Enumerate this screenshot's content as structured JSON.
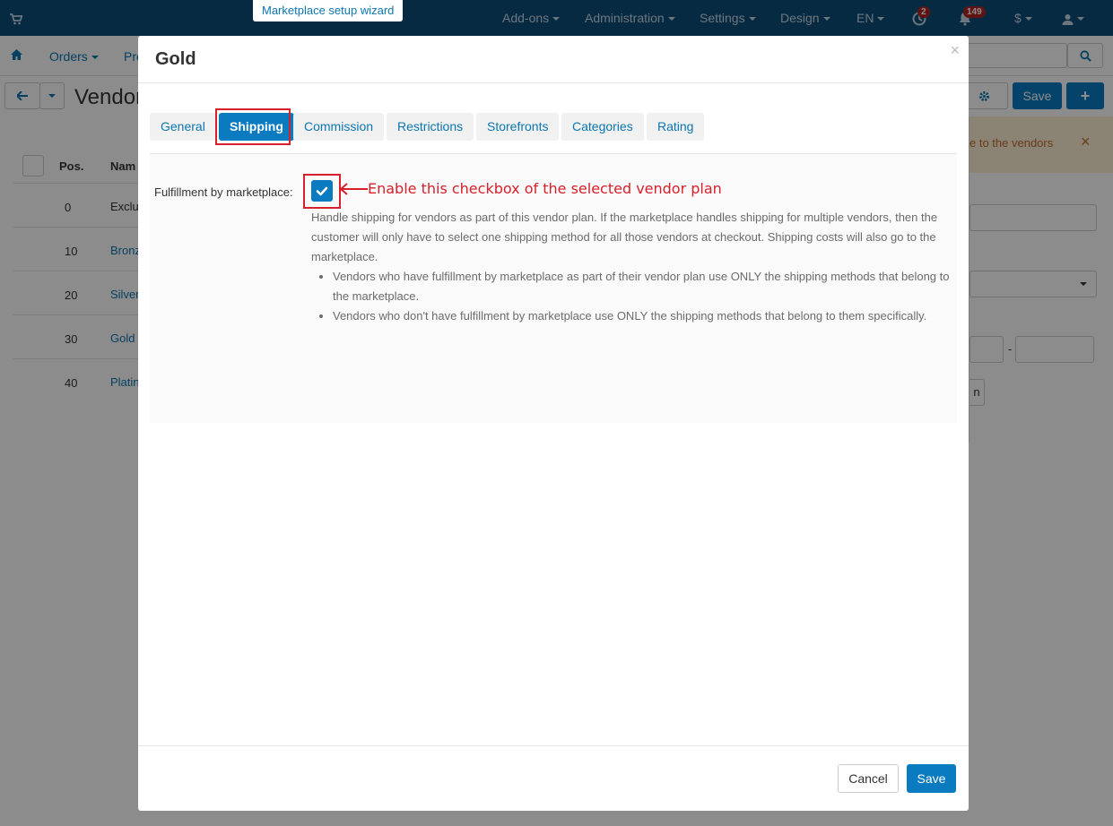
{
  "topbar": {
    "wizard_label": "Marketplace setup wizard",
    "nav": [
      "Add-ons",
      "Administration",
      "Settings",
      "Design",
      "EN"
    ],
    "notif_badge_1": "2",
    "notif_badge_2": "149",
    "currency": "$"
  },
  "secondbar": {
    "orders": "Orders",
    "products_partial": "Pro"
  },
  "toolbar": {
    "page_title_partial": "Vendor",
    "save_label": "Save"
  },
  "background_list": {
    "headers": {
      "pos": "Pos.",
      "name": "Nam"
    },
    "rows": [
      {
        "pos": "0",
        "name": "Exclu"
      },
      {
        "pos": "10",
        "name": "Bronz"
      },
      {
        "pos": "20",
        "name": "Silver"
      },
      {
        "pos": "30",
        "name": "Gold"
      },
      {
        "pos": "40",
        "name": "Platin"
      }
    ]
  },
  "background_right": {
    "alert_partial": "e to the vendors",
    "dash": "-",
    "btn_partial": "n"
  },
  "modal": {
    "title": "Gold",
    "tabs": [
      "General",
      "Shipping",
      "Commission",
      "Restrictions",
      "Storefronts",
      "Categories",
      "Rating"
    ],
    "active_tab": "Shipping",
    "field_label": "Fulfillment by marketplace:",
    "checkbox_checked": true,
    "annotation": "Enable this checkbox of the selected vendor plan",
    "help_text": "Handle shipping for vendors as part of this vendor plan. If the marketplace handles shipping for multiple vendors, then the customer will only have to select one shipping method for all those vendors at checkout. Shipping costs will also go to the marketplace.",
    "help_bullets": [
      "Vendors who have fulfillment by marketplace as part of their vendor plan use ONLY the shipping methods that belong to the marketplace.",
      "Vendors who don't have fulfillment by marketplace use ONLY the shipping methods that belong to them specifically."
    ],
    "cancel_label": "Cancel",
    "save_label": "Save"
  },
  "colors": {
    "topbar": "#0d4e7a",
    "accent": "#0b7bc1",
    "annotation_red": "#d6202b"
  }
}
